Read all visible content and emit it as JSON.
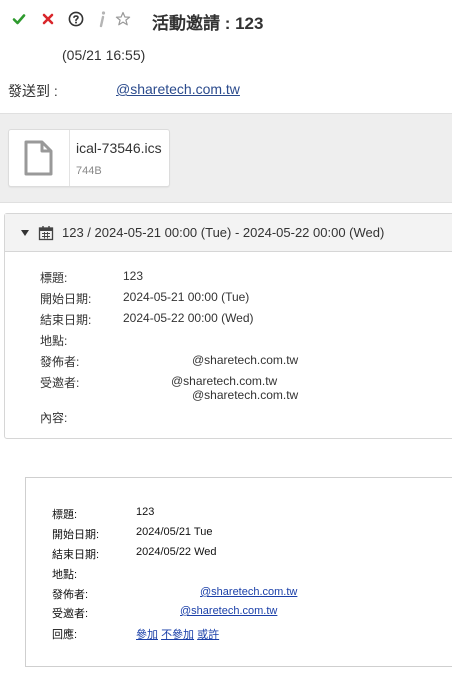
{
  "toolbar": {
    "accept_icon": "check-icon",
    "decline_icon": "x-icon",
    "tentative_icon": "question-icon",
    "info_icon": "info-icon",
    "star_icon": "star-icon",
    "accept_color": "#2e9a2e",
    "decline_color": "#d9262b"
  },
  "message": {
    "title": "活動邀請 : 123",
    "sender_time": "(05/21 16:55)",
    "send_to_label": "發送到 :",
    "send_to_email": "@sharetech.com.tw"
  },
  "attachment": {
    "name": "ical-73546.ics",
    "size": "744B",
    "icon": "file-icon"
  },
  "event": {
    "header": "123 / 2024-05-21 00:00 (Tue) - 2024-05-22 00:00 (Wed)",
    "rows": [
      {
        "label": "標題:",
        "value": "123"
      },
      {
        "label": "開始日期:",
        "value": "2024-05-21 00:00 (Tue)"
      },
      {
        "label": "結束日期:",
        "value": "2024-05-22 00:00 (Wed)"
      },
      {
        "label": "地點:",
        "value": ""
      },
      {
        "label": "發佈者:",
        "value": "@sharetech.com.tw"
      },
      {
        "label": "受邀者:",
        "value": "@sharetech.com.tw"
      },
      {
        "label": "",
        "value": "@sharetech.com.tw"
      },
      {
        "label": "內容:",
        "value": ""
      }
    ]
  },
  "invite": {
    "rows": [
      {
        "label": "標題:",
        "value": "123"
      },
      {
        "label": "開始日期:",
        "value": "2024/05/21 Tue"
      },
      {
        "label": "結束日期:",
        "value": "2024/05/22 Wed"
      },
      {
        "label": "地點:",
        "value": ""
      },
      {
        "label": "發佈者:",
        "value": "@sharetech.com.tw"
      },
      {
        "label": "受邀者:",
        "value": "@sharetech.com.tw"
      },
      {
        "label": "回應:",
        "value": ""
      }
    ],
    "responses": {
      "accept": "參加",
      "decline": "不參加",
      "maybe": "或許"
    }
  }
}
